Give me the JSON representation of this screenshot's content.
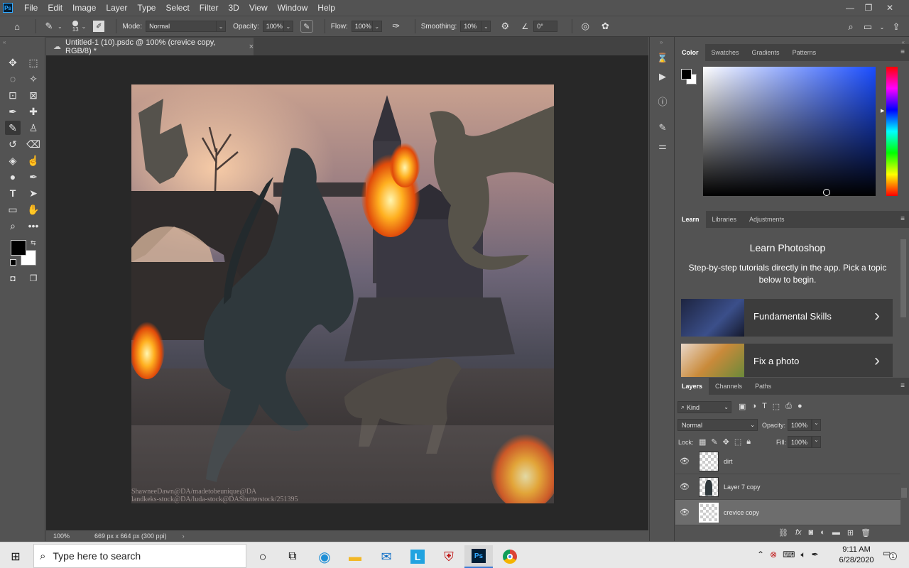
{
  "app": {
    "logo": "Ps"
  },
  "menu": [
    "File",
    "Edit",
    "Image",
    "Layer",
    "Type",
    "Select",
    "Filter",
    "3D",
    "View",
    "Window",
    "Help"
  ],
  "window_controls": {
    "minimize": "—",
    "restore": "❐",
    "close": "✕"
  },
  "options": {
    "brush_size": "13",
    "mode_label": "Mode:",
    "mode_value": "Normal",
    "opacity_label": "Opacity:",
    "opacity_value": "100%",
    "flow_label": "Flow:",
    "flow_value": "100%",
    "smoothing_label": "Smoothing:",
    "smoothing_value": "10%",
    "angle_value": "0°"
  },
  "document": {
    "tab_title": "Untitled-1 (10).psdc @ 100% (crevice copy, RGB/8) *",
    "close": "×",
    "zoom": "100%",
    "dimensions": "669 px x 664 px (300 ppi)",
    "credit_line1": "ShawneeDawn@DA/madetobeunique@DA",
    "credit_line2": "landkeks-stock@DA/luda-stock@DAShutterstock/251395"
  },
  "color_panel": {
    "tabs": [
      "Color",
      "Swatches",
      "Gradients",
      "Patterns"
    ],
    "hue_color": "#1a4dff",
    "foreground": "#000000",
    "background": "#ffffff"
  },
  "learn_panel": {
    "tabs": [
      "Learn",
      "Libraries",
      "Adjustments"
    ],
    "title": "Learn Photoshop",
    "description": "Step-by-step tutorials directly in the app. Pick a topic below to begin.",
    "cards": [
      {
        "label": "Fundamental Skills",
        "arrow": "›"
      },
      {
        "label": "Fix a photo",
        "arrow": "›"
      }
    ]
  },
  "layers_panel": {
    "tabs": [
      "Layers",
      "Channels",
      "Paths"
    ],
    "filter_label": "Kind",
    "blend_mode": "Normal",
    "opacity_label": "Opacity:",
    "opacity_value": "100%",
    "lock_label": "Lock:",
    "fill_label": "Fill:",
    "fill_value": "100%",
    "layers": [
      {
        "name": "dirt",
        "selected": false
      },
      {
        "name": "Layer 7 copy",
        "selected": false
      },
      {
        "name": "crevice copy",
        "selected": true
      }
    ]
  },
  "taskbar": {
    "search_placeholder": "Type here to search",
    "time": "9:11 AM",
    "date": "6/28/2020",
    "notification_count": "1"
  }
}
